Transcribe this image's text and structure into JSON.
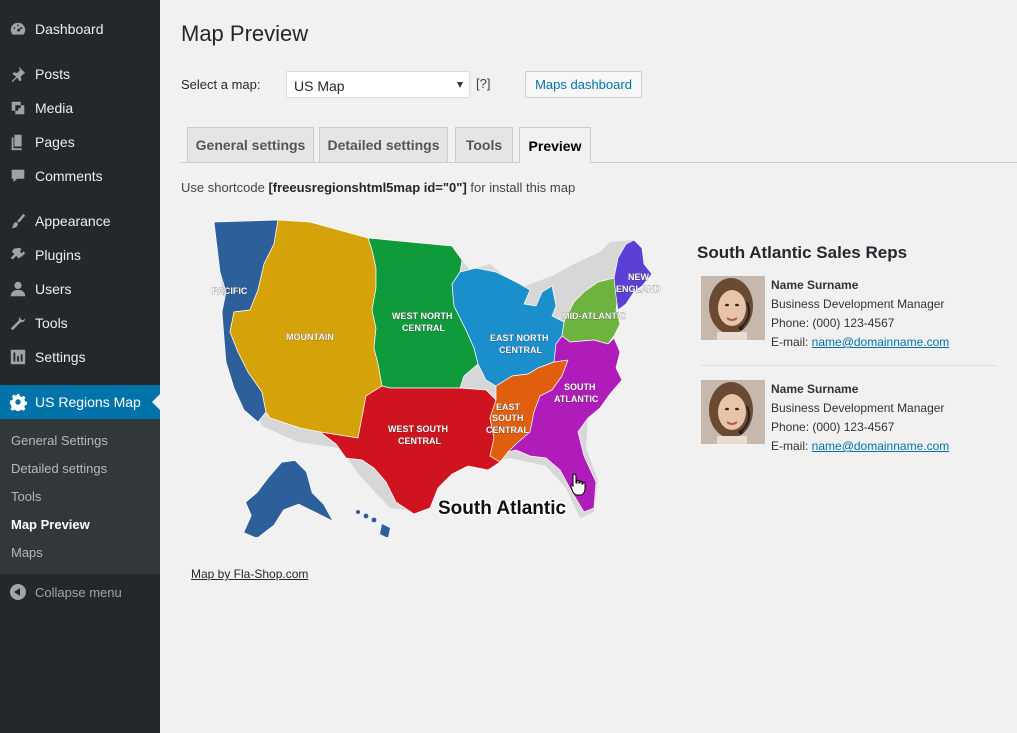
{
  "sidebar": {
    "items": [
      {
        "label": "Dashboard",
        "icon": "dashboard-icon"
      },
      {
        "label": "Posts",
        "icon": "pin-icon"
      },
      {
        "label": "Media",
        "icon": "media-icon"
      },
      {
        "label": "Pages",
        "icon": "pages-icon"
      },
      {
        "label": "Comments",
        "icon": "comment-icon"
      },
      {
        "label": "Appearance",
        "icon": "brush-icon"
      },
      {
        "label": "Plugins",
        "icon": "plug-icon"
      },
      {
        "label": "Users",
        "icon": "user-icon"
      },
      {
        "label": "Tools",
        "icon": "wrench-icon"
      },
      {
        "label": "Settings",
        "icon": "sliders-icon"
      },
      {
        "label": "US Regions Map",
        "icon": "gear-icon"
      }
    ],
    "submenu": [
      "General Settings",
      "Detailed settings",
      "Tools",
      "Map Preview",
      "Maps"
    ],
    "collapse": "Collapse menu"
  },
  "page": {
    "title": "Map Preview",
    "select_label": "Select a map:",
    "selected_map": "US Map",
    "help": "[?]",
    "dashboard_button": "Maps dashboard",
    "tabs": [
      "General settings",
      "Detailed settings",
      "Tools",
      "Preview"
    ],
    "shortcode_prefix": "Use shortcode ",
    "shortcode": "[freeusregionshtml5map id=\"0\"]",
    "shortcode_suffix": " for install this map"
  },
  "map": {
    "regions": {
      "pacific": "PACIFIC",
      "mountain": "MOUNTAIN",
      "wnc1": "WEST NORTH",
      "wnc2": "CENTRAL",
      "enc1": "EAST NORTH",
      "enc2": "CENTRAL",
      "midatl": "MID-ATLANTIC",
      "ne1": "NEW",
      "ne2": "ENGLAND",
      "wsc1": "WEST SOUTH",
      "wsc2": "CENTRAL",
      "esc1": "EAST",
      "esc2": "SOUTH",
      "esc3": "CENTRAL",
      "sa1": "SOUTH",
      "sa2": "ATLANTIC"
    },
    "hover_label": "South Atlantic",
    "credit": "Map by Fla-Shop.com",
    "colors": {
      "pacific": "#2d5f9a",
      "mountain": "#d6a20a",
      "wnc": "#0f9a3c",
      "enc": "#1a8fcc",
      "midatl": "#6db33f",
      "ne": "#5b3fd6",
      "wsc": "#d0141f",
      "esc": "#e05e0d",
      "sa": "#b01cb9",
      "outline": "#cfcfcf"
    }
  },
  "reps": {
    "title": "South Atlantic Sales Reps",
    "cards": [
      {
        "name": "Name Surname",
        "role": "Business Development Manager",
        "phone": "Phone: (000) 123-4567",
        "email_label": "E-mail: ",
        "email": "name@domainname.com"
      },
      {
        "name": "Name Surname",
        "role": "Business Development Manager",
        "phone": "Phone: (000) 123-4567",
        "email_label": "E-mail: ",
        "email": "name@domainname.com"
      }
    ]
  }
}
